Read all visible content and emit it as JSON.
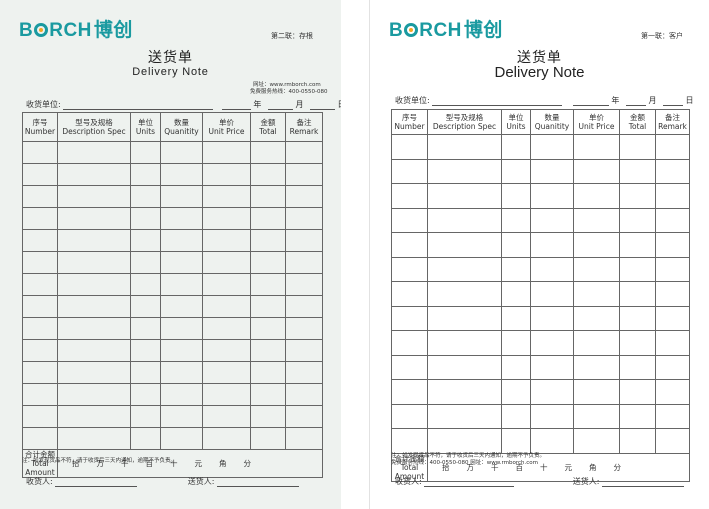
{
  "logo": {
    "latin": "BORCH",
    "cn": "博创"
  },
  "colors": {
    "brand": "#1a9aa0",
    "logo_dot": "#f5a623"
  },
  "common": {
    "title_cn": "送货单",
    "title_en": "Delivery Note",
    "recv_unit": "收货单位:",
    "year": "年",
    "month": "月",
    "day": "日",
    "headers": [
      {
        "cn": "序号",
        "en": "Number"
      },
      {
        "cn": "型号及规格",
        "en": "Description Spec"
      },
      {
        "cn": "单位",
        "en": "Units"
      },
      {
        "cn": "数量",
        "en": "Quanitity"
      },
      {
        "cn": "单价",
        "en": "Unit Price"
      },
      {
        "cn": "金额",
        "en": "Total"
      },
      {
        "cn": "备注",
        "en": "Remark"
      }
    ],
    "total_cn": "合计金额",
    "total_en": "Total Amount",
    "digits": [
      "拾",
      "万",
      "千",
      "百",
      "十",
      "元",
      "角",
      "分"
    ],
    "receiver": "收货人:",
    "deliverer": "送货人:"
  },
  "left": {
    "copy_label": "第二联：存根",
    "website_line1": "网址：www.rmborch.com",
    "website_line2": "免费服务热线：400-0550-080",
    "note_line1": "注：如发现货品不符，请于收货后三天内通知，逾期不予负责。"
  },
  "right": {
    "copy_label": "第一联：客户",
    "note_line1": "注：如发现货品不符，请于收货后三天内通知，逾期不予负责。",
    "note_line2": "免费服务热线：400-0550-080   网址：www.rmborch.com"
  }
}
